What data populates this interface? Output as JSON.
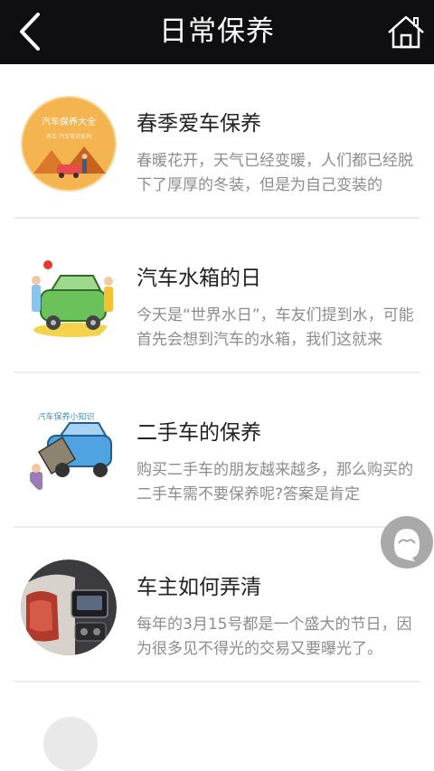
{
  "header": {
    "title": "日常保养"
  },
  "articles": [
    {
      "title": "春季爱车保养",
      "desc": "春暖花开，天气已经变暖，人们都已经脱下了厚厚的冬装，但是为自己变装的",
      "thumb_text": "汽车保养大全",
      "thumb_subtext": "养车·汽车常识系列"
    },
    {
      "title": "汽车水箱的日",
      "desc": "今天是“世界水日”，车友们提到水，可能首先会想到汽车的水箱，我们这就来"
    },
    {
      "title": "二手车的保养",
      "desc": "购买二手车的朋友越来越多，那么购买的二手车需不要保养呢?答案是肯定",
      "thumb_text": "汽车保养小知识"
    },
    {
      "title": "车主如何弄清",
      "desc": "每年的3月15号都是一个盛大的节日，因为很多见不得光的交易又要曝光了。"
    }
  ],
  "colors": {
    "topbar": "#0f0f12",
    "thumb1_bg": "#f4b450",
    "fab": "#a9a9a9"
  }
}
